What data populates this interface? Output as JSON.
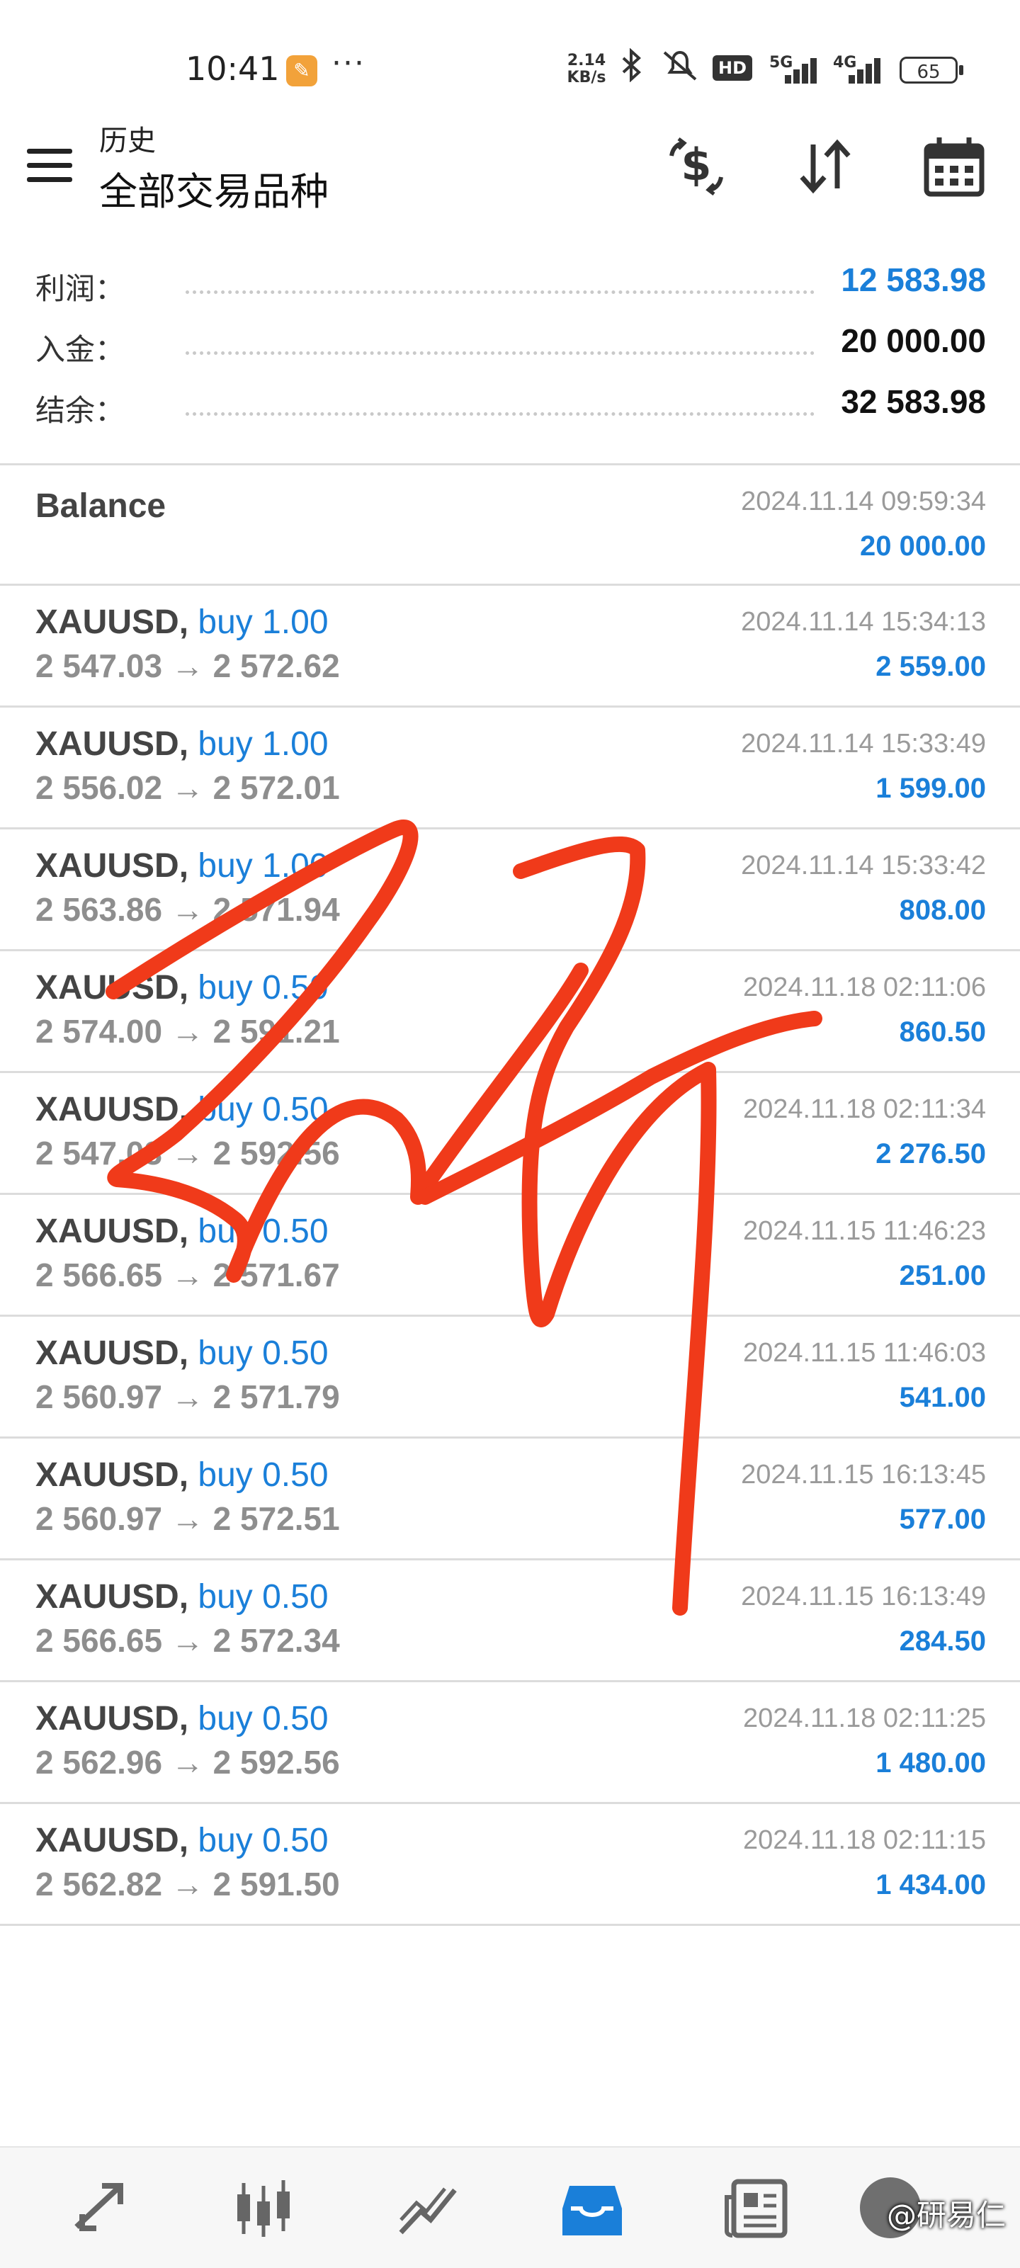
{
  "status_bar": {
    "time": "10:41",
    "net_speed_value": "2.14",
    "net_speed_unit": "KB/s",
    "hd_label": "HD",
    "signal1_label": "5G",
    "signal2_label": "4G",
    "battery": "65"
  },
  "header": {
    "subtitle": "历史",
    "title": "全部交易品种"
  },
  "summary": {
    "rows": [
      {
        "label": "利润：",
        "value": "12 583.98",
        "color": "#1a7fd9"
      },
      {
        "label": "入金：",
        "value": "20 000.00",
        "color": "#111111"
      },
      {
        "label": "结余：",
        "value": "32 583.98",
        "color": "#111111"
      }
    ]
  },
  "balance_entry": {
    "label": "Balance",
    "timestamp": "2024.11.14 09:59:34",
    "amount": "20 000.00"
  },
  "deals": [
    {
      "symbol": "XAUUSD,",
      "side": "buy 1.00",
      "prices": "2 547.03 → 2 572.62",
      "timestamp": "2024.11.14 15:34:13",
      "profit": "2 559.00"
    },
    {
      "symbol": "XAUUSD,",
      "side": "buy 1.00",
      "prices": "2 556.02 → 2 572.01",
      "timestamp": "2024.11.14 15:33:49",
      "profit": "1 599.00"
    },
    {
      "symbol": "XAUUSD,",
      "side": "buy 1.00",
      "prices": "2 563.86 → 2 571.94",
      "timestamp": "2024.11.14 15:33:42",
      "profit": "808.00"
    },
    {
      "symbol": "XAUUSD,",
      "side": "buy 0.50",
      "prices": "2 574.00 → 2 591.21",
      "timestamp": "2024.11.18 02:11:06",
      "profit": "860.50"
    },
    {
      "symbol": "XAUUSD,",
      "side": "buy 0.50",
      "prices": "2 547.03 → 2 592.56",
      "timestamp": "2024.11.18 02:11:34",
      "profit": "2 276.50"
    },
    {
      "symbol": "XAUUSD,",
      "side": "buy 0.50",
      "prices": "2 566.65 → 2 571.67",
      "timestamp": "2024.11.15 11:46:23",
      "profit": "251.00"
    },
    {
      "symbol": "XAUUSD,",
      "side": "buy 0.50",
      "prices": "2 560.97 → 2 571.79",
      "timestamp": "2024.11.15 11:46:03",
      "profit": "541.00"
    },
    {
      "symbol": "XAUUSD,",
      "side": "buy 0.50",
      "prices": "2 560.97 → 2 572.51",
      "timestamp": "2024.11.15 16:13:45",
      "profit": "577.00"
    },
    {
      "symbol": "XAUUSD,",
      "side": "buy 0.50",
      "prices": "2 566.65 → 2 572.34",
      "timestamp": "2024.11.15 16:13:49",
      "profit": "284.50"
    },
    {
      "symbol": "XAUUSD,",
      "side": "buy 0.50",
      "prices": "2 562.96 → 2 592.56",
      "timestamp": "2024.11.18 02:11:25",
      "profit": "1 480.00"
    },
    {
      "symbol": "XAUUSD,",
      "side": "buy 0.50",
      "prices": "2 562.82 → 2 591.50",
      "timestamp": "2024.11.18 02:11:15",
      "profit": "1 434.00"
    }
  ],
  "bottom_nav": {
    "items": [
      {
        "icon": "quotes-arrows-icon"
      },
      {
        "icon": "candlestick-chart-icon"
      },
      {
        "icon": "trade-line-icon"
      },
      {
        "icon": "history-inbox-icon",
        "active": true
      },
      {
        "icon": "news-icon"
      }
    ],
    "active_color": "#1a7fd9"
  },
  "watermark": "@研易仁",
  "accent_color": "#1a7fd9",
  "scribble_color": "#f03a1a"
}
